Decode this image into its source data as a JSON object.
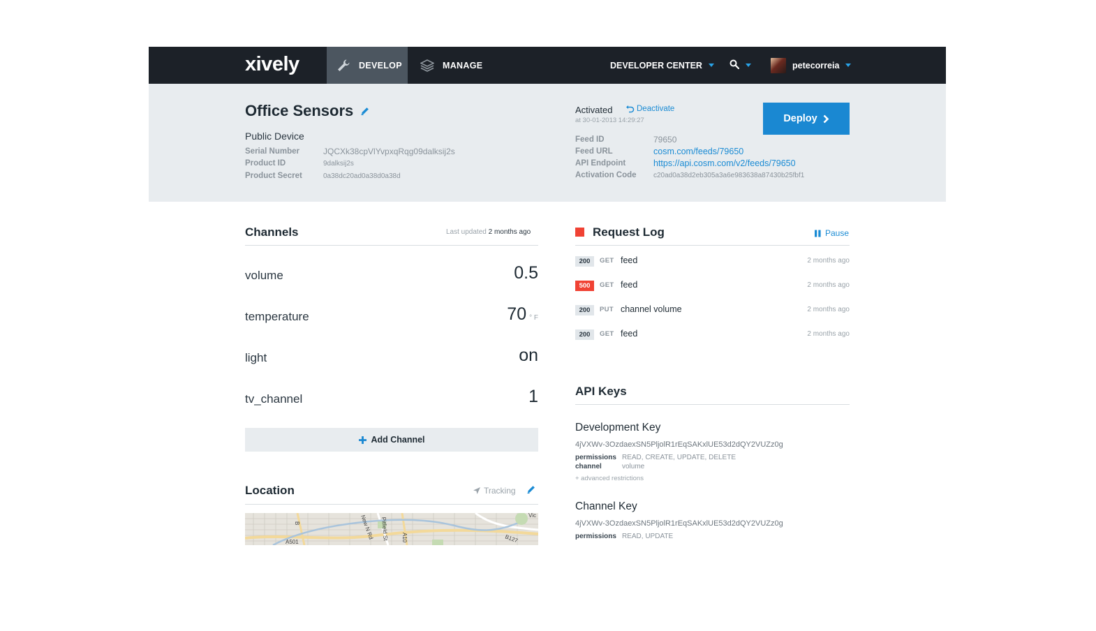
{
  "nav": {
    "logo": "xively",
    "develop_label": "DEVELOP",
    "manage_label": "MANAGE",
    "developer_center_label": "DEVELOPER CENTER",
    "username": "petecorreia"
  },
  "device": {
    "name": "Office Sensors",
    "type_label": "Public Device",
    "serial_number_label": "Serial Number",
    "serial_number": "JQCXk38cpVlYvpxqRqg09dalksij2s",
    "product_id_label": "Product ID",
    "product_id": "9dalksij2s",
    "product_secret_label": "Product Secret",
    "product_secret": "0a38dc20ad0a38d0a38d",
    "status": "Activated",
    "deactivate_label": "Deactivate",
    "activated_at": "at 30-01-2013 14:29:27",
    "deploy_label": "Deploy",
    "feed_id_label": "Feed ID",
    "feed_id": "79650",
    "feed_url_label": "Feed URL",
    "feed_url": "cosm.com/feeds/79650",
    "api_endpoint_label": "API Endpoint",
    "api_endpoint": "https://api.cosm.com/v2/feeds/79650",
    "activation_code_label": "Activation Code",
    "activation_code": "c20ad0a38d2eb305a3a6e983638a87430b25fbf1"
  },
  "channels": {
    "title": "Channels",
    "last_updated_prefix": "Last updated",
    "last_updated_value": "2 months ago",
    "items": [
      {
        "name": "volume",
        "value": "0.5",
        "unit": ""
      },
      {
        "name": "temperature",
        "value": "70",
        "unit": "° F"
      },
      {
        "name": "light",
        "value": "on",
        "unit": ""
      },
      {
        "name": "tv_channel",
        "value": "1",
        "unit": ""
      }
    ],
    "add_label": "Add Channel"
  },
  "location": {
    "title": "Location",
    "tracking_label": "Tracking"
  },
  "request_log": {
    "title": "Request Log",
    "pause_label": "Pause",
    "entries": [
      {
        "status": "200",
        "method": "GET",
        "resource": "feed",
        "time": "2 months ago"
      },
      {
        "status": "500",
        "method": "GET",
        "resource": "feed",
        "time": "2 months ago"
      },
      {
        "status": "200",
        "method": "PUT",
        "resource": "channel volume",
        "time": "2 months ago"
      },
      {
        "status": "200",
        "method": "GET",
        "resource": "feed",
        "time": "2 months ago"
      }
    ]
  },
  "api_keys": {
    "title": "API Keys",
    "permissions_label": "permissions",
    "channel_label": "channel",
    "keys": [
      {
        "name": "Development Key",
        "key": "4jVXWv-3OzdaexSN5PljolR1rEqSAKxlUE53d2dQY2VUZz0g",
        "permissions": "READ, CREATE, UPDATE, DELETE",
        "channel": "volume",
        "advanced": "+ advanced restrictions"
      },
      {
        "name": "Channel Key",
        "key": "4jVXWv-3OzdaexSN5PljolR1rEqSAKxlUE53d2dQY2VUZz0g",
        "permissions": "READ, UPDATE"
      }
    ]
  },
  "map_labels": [
    "B",
    "New N Rd",
    "Pitfield St",
    "A10",
    "A501",
    "B127",
    "Vic"
  ],
  "colors": {
    "nav_bg": "#1c2128",
    "accent_blue": "#1a88d2",
    "error_red": "#f04234",
    "header_bg": "#e8ecef"
  }
}
